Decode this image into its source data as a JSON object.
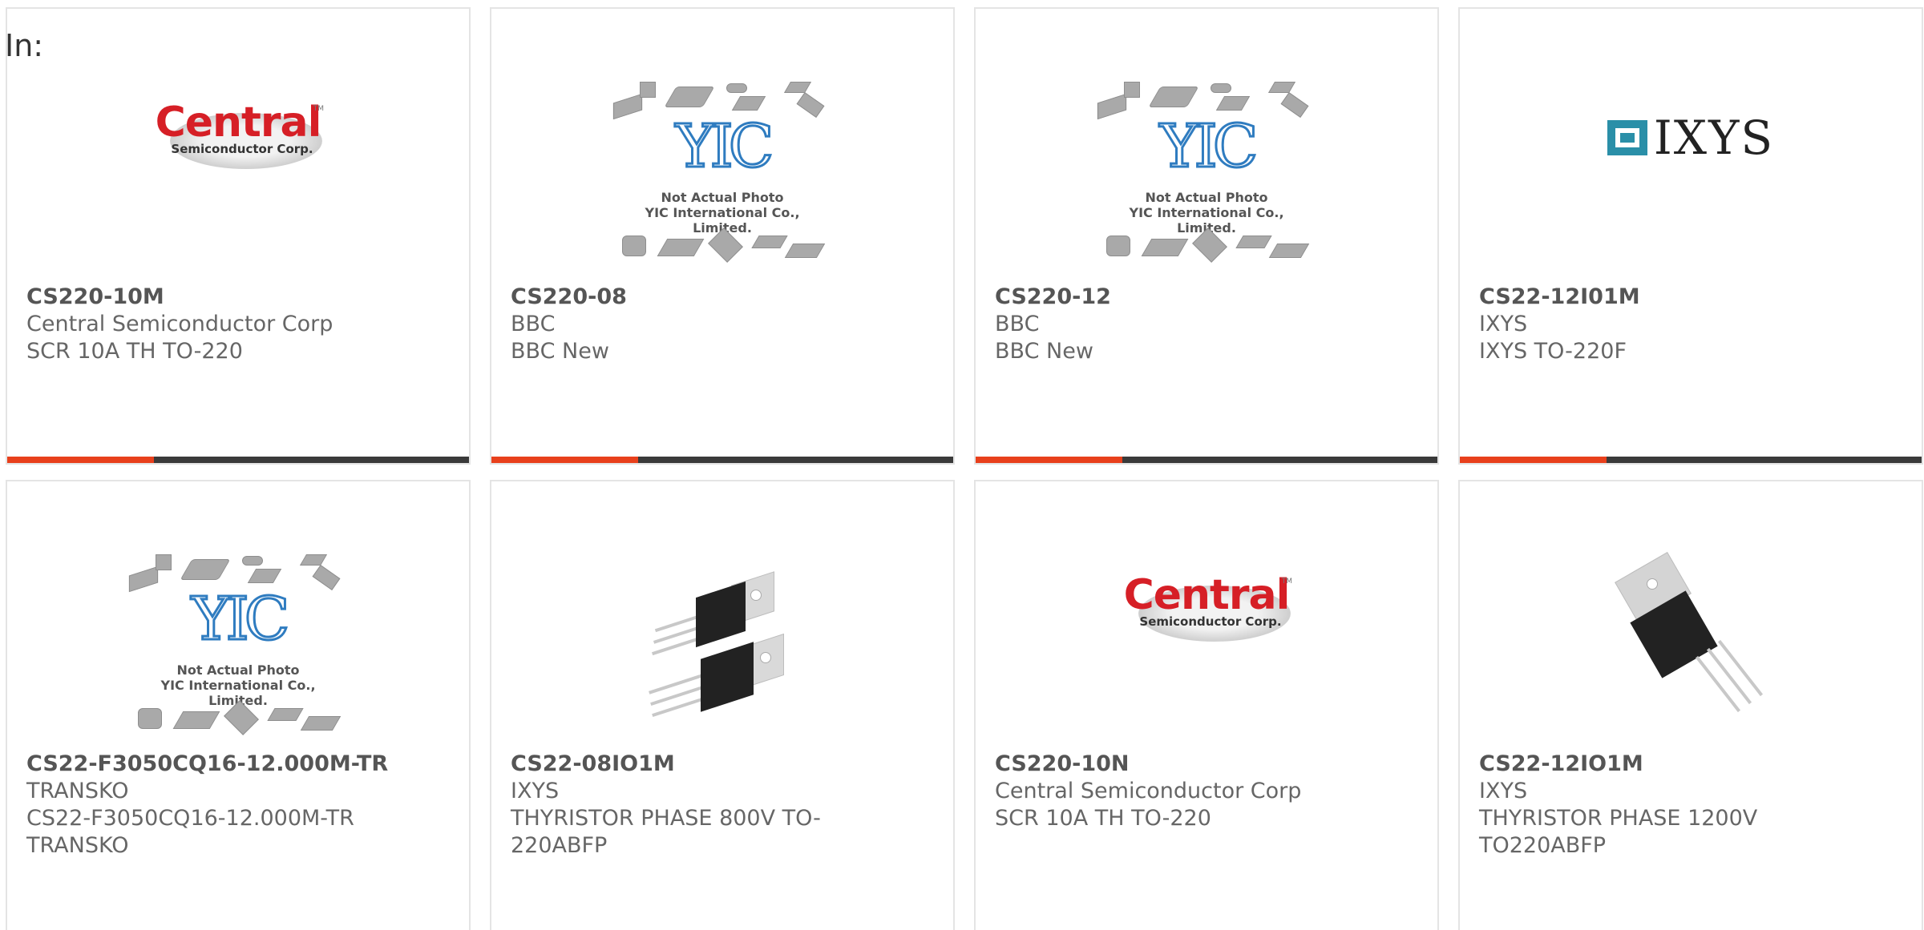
{
  "page": {
    "in_label": "In:"
  },
  "products": [
    {
      "part": "CS220-10M",
      "manufacturer": "Central Semiconductor Corp",
      "description": "SCR 10A TH TO-220",
      "image": "central-semiconductor-logo"
    },
    {
      "part": "CS220-08",
      "manufacturer": "BBC",
      "description": "BBC New",
      "image": "yic-not-actual-photo"
    },
    {
      "part": "CS220-12",
      "manufacturer": "BBC",
      "description": "BBC New",
      "image": "yic-not-actual-photo"
    },
    {
      "part": "CS22-12I01M",
      "manufacturer": "IXYS",
      "description": "IXYS TO-220F",
      "image": "ixys-logo"
    },
    {
      "part": "CS22-F3050CQ16-12.000M-TR",
      "manufacturer": "TRANSKO",
      "description": "CS22-F3050CQ16-12.000M-TR TRANSKO",
      "image": "yic-not-actual-photo"
    },
    {
      "part": "CS22-08IO1M",
      "manufacturer": "IXYS",
      "description": "THYRISTOR PHASE 800V TO-220ABFP",
      "image": "to220-pair-photo"
    },
    {
      "part": "CS220-10N",
      "manufacturer": "Central Semiconductor Corp",
      "description": "SCR 10A TH TO-220",
      "image": "central-semiconductor-logo"
    },
    {
      "part": "CS22-12IO1M",
      "manufacturer": "IXYS",
      "description": "THYRISTOR PHASE 1200V TO220ABFP",
      "image": "to220-single-photo"
    }
  ],
  "images": {
    "central": {
      "word": "Central",
      "sub": "Semiconductor Corp.",
      "tm": "TM"
    },
    "yic": {
      "mark": "YIC",
      "caption_1": "Not Actual Photo",
      "caption_2": "YIC International Co., Limited."
    },
    "ixys": {
      "word": "IXYS"
    }
  },
  "colors": {
    "accent": "#e8401c",
    "bar": "#3a3a3a",
    "border": "#e4e4e4",
    "text": "#666666",
    "yic_blue": "#2f7cc0",
    "central_red": "#d61f26",
    "ixys_teal": "#2a8fa8"
  }
}
